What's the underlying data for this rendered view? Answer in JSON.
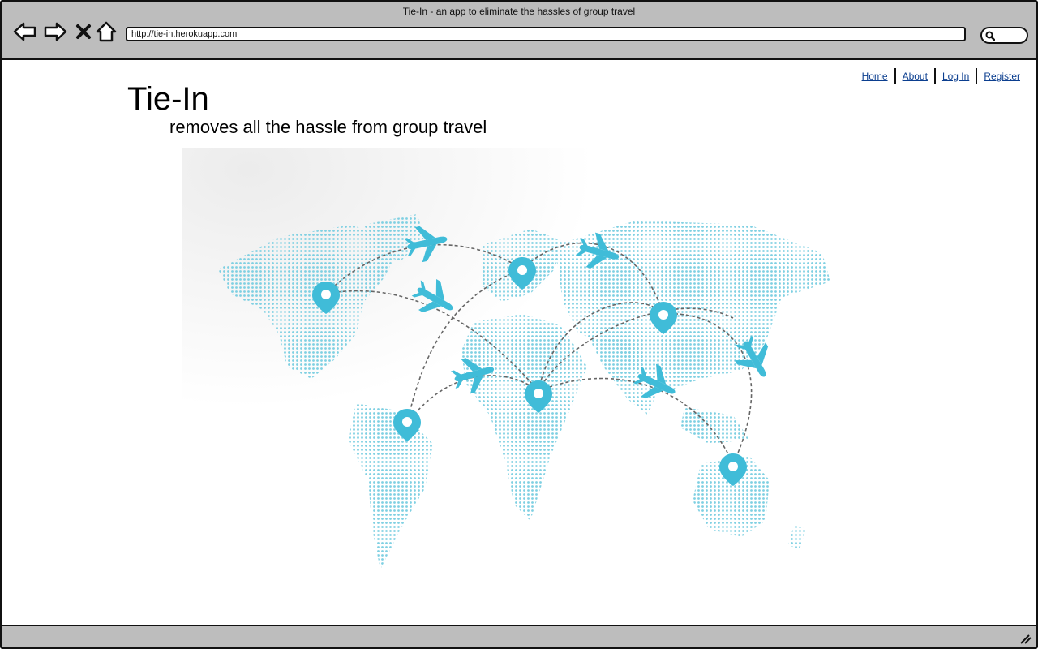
{
  "window": {
    "title": "Tie-In - an app to eliminate the hassles of group travel"
  },
  "browser": {
    "url": "http://tie-in.herokuapp.com",
    "search_placeholder": ""
  },
  "nav": {
    "items": [
      {
        "label": "Home"
      },
      {
        "label": "About"
      },
      {
        "label": "Log In"
      },
      {
        "label": "Register"
      }
    ]
  },
  "hero": {
    "title": "Tie-In",
    "tagline": "removes all the hassle from group travel",
    "image_icon": "world-map-flights-icon"
  },
  "colors": {
    "accent": "#40bcd8",
    "link": "#0b3e8f",
    "chrome": "#bdbdbd"
  }
}
